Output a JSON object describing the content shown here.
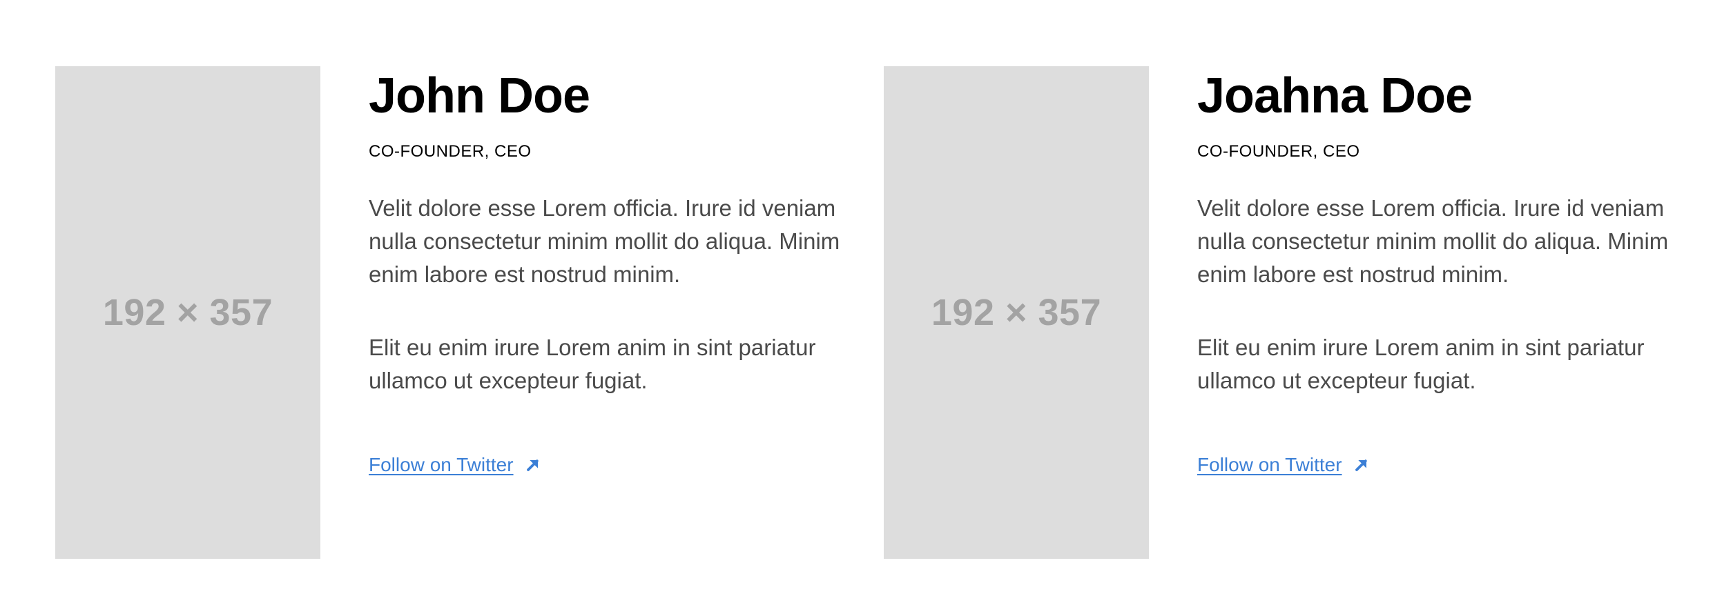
{
  "team": [
    {
      "photo_placeholder": "192 × 357",
      "name": "John Doe",
      "role": "CO-FOUNDER, CEO",
      "bio": [
        "Velit dolore esse Lorem officia. Irure id veniam nulla consectetur minim mollit do aliqua. Minim enim labore est nostrud minim.",
        "Elit eu enim irure Lorem anim in sint pariatur ullamco ut excepteur fugiat."
      ],
      "link_label": "Follow on Twitter",
      "link_icon": "arrow-up-right-icon"
    },
    {
      "photo_placeholder": "192 × 357",
      "name": "Joahna Doe",
      "role": "CO-FOUNDER, CEO",
      "bio": [
        "Velit dolore esse Lorem officia. Irure id veniam nulla consectetur minim mollit do aliqua. Minim enim labore est nostrud minim.",
        "Elit eu enim irure Lorem anim in sint pariatur ullamco ut excepteur fugiat."
      ],
      "link_label": "Follow on Twitter",
      "link_icon": "arrow-up-right-icon"
    }
  ],
  "colors": {
    "link": "#3b7fd6",
    "placeholder_bg": "#dddddd",
    "placeholder_text": "#a3a3a3",
    "body_text": "#4a4a4a"
  }
}
